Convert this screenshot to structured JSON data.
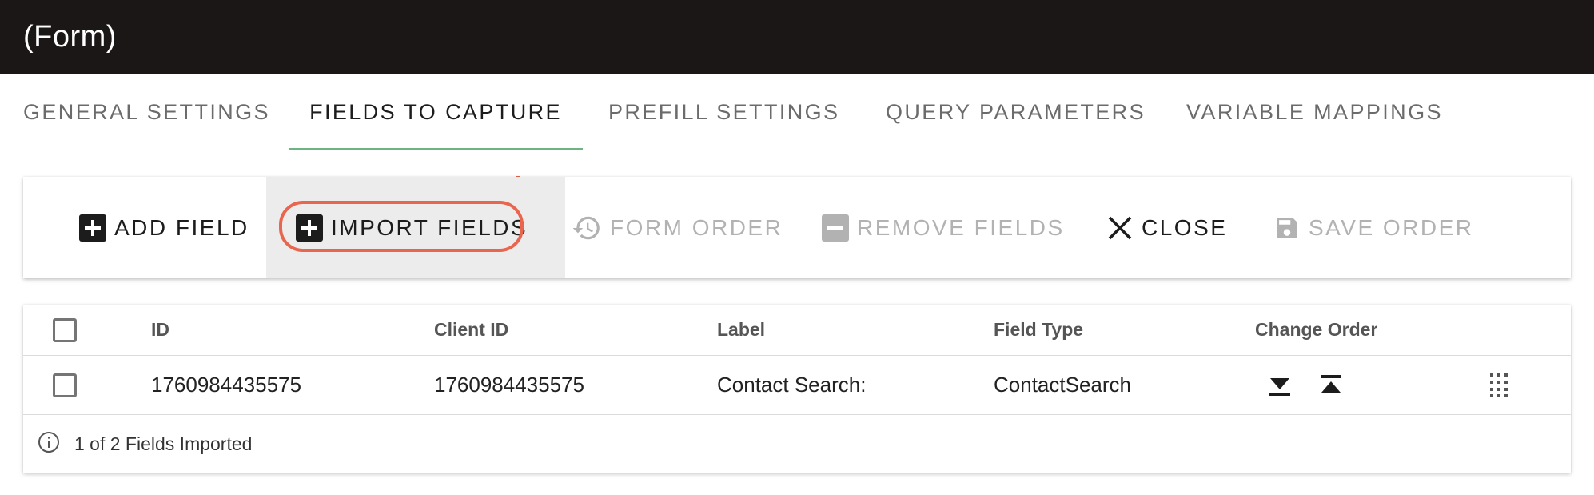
{
  "window": {
    "title": "(Form)"
  },
  "tabs": [
    {
      "label": "General Settings",
      "active": false
    },
    {
      "label": "Fields to Capture",
      "active": true
    },
    {
      "label": "Prefill Settings",
      "active": false
    },
    {
      "label": "Query Parameters",
      "active": false
    },
    {
      "label": "Variable Mappings",
      "active": false
    }
  ],
  "toolbar": {
    "add_field": {
      "label": "Add Field",
      "icon": "plus-box-icon",
      "disabled": false
    },
    "import_fields": {
      "label": "Import Fields",
      "icon": "plus-box-icon",
      "disabled": false,
      "highlighted": true
    },
    "form_order": {
      "label": "Form Order",
      "icon": "history-icon",
      "disabled": true
    },
    "remove_fields": {
      "label": "Remove Fields",
      "icon": "minus-box-icon",
      "disabled": true
    },
    "close": {
      "label": "Close",
      "icon": "close-icon",
      "disabled": false
    },
    "save_order": {
      "label": "Save Order",
      "icon": "save-icon",
      "disabled": true
    }
  },
  "table": {
    "columns": [
      "ID",
      "Client ID",
      "Label",
      "Field Type",
      "Change Order"
    ],
    "rows": [
      {
        "id": "1760984435575",
        "client_id": "1760984435575",
        "label": "Contact Search:",
        "field_type": "ContactSearch"
      }
    ],
    "footer": {
      "message": "1 of 2 Fields Imported",
      "icon": "info-icon"
    }
  },
  "colors": {
    "titlebar_bg": "#1c1717",
    "tab_indicator": "#6cb482",
    "highlight_ring": "#e8654e",
    "disabled_text": "#b2b2b2"
  }
}
